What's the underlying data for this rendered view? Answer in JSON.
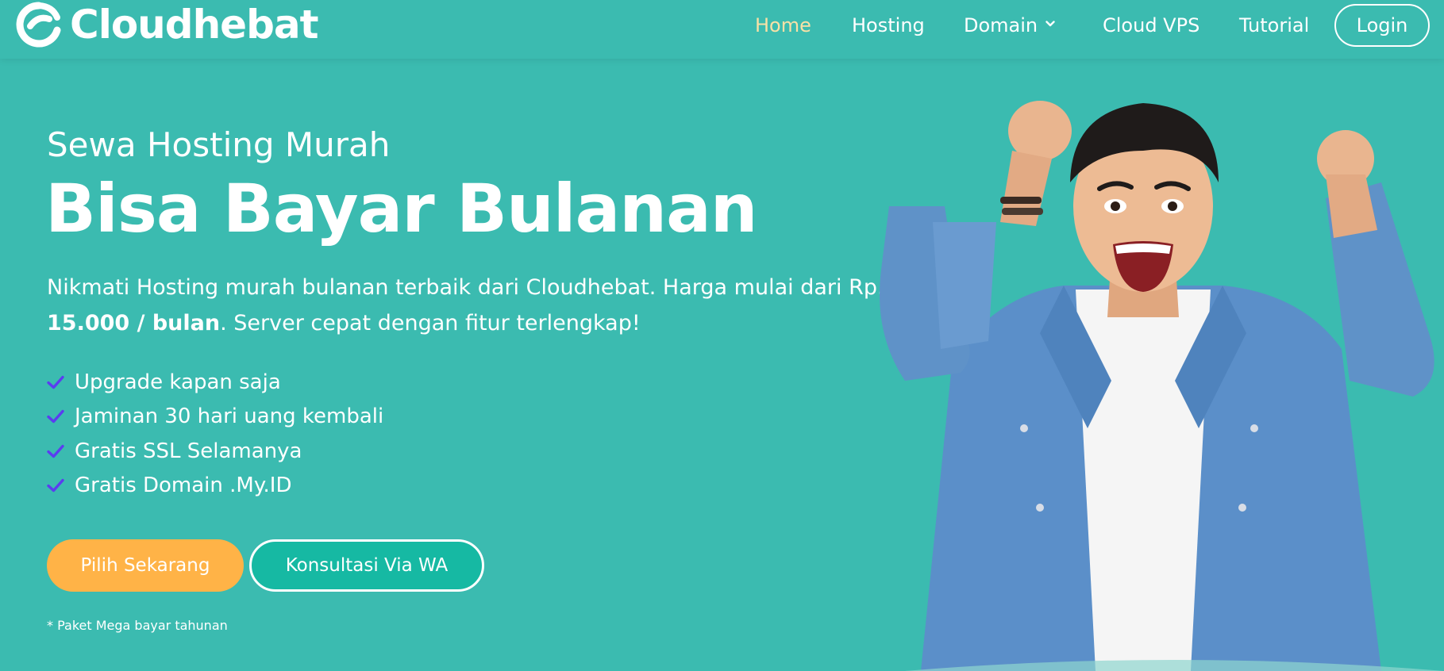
{
  "brand": {
    "name": "Cloudhebat",
    "logo_icon": "cloudhebat-logo-icon"
  },
  "nav": {
    "home": "Home",
    "hosting": "Hosting",
    "domain": "Domain",
    "cloud_vps": "Cloud VPS",
    "tutorial": "Tutorial",
    "login": "Login",
    "active_item": "Home"
  },
  "hero": {
    "subtitle": "Sewa Hosting Murah",
    "title": "Bisa Bayar Bulanan",
    "description_part1": "Nikmati Hosting murah bulanan terbaik dari Cloudhebat. Harga mulai dari Rp.",
    "description_price": "15.000 / bulan",
    "description_part2": ". Server cepat dengan fitur terlengkap!",
    "features": [
      "Upgrade kapan saja",
      "Jaminan 30 hari uang kembali",
      "Gratis SSL Selamanya",
      "Gratis Domain .My.ID"
    ],
    "primary_button": "Pilih Sekarang",
    "secondary_button": "Konsultasi Via WA",
    "footnote": "* Paket Mega bayar tahunan",
    "illustration": "excited-man-photo"
  },
  "colors": {
    "background": "#3bbbb0",
    "nav_active": "#f8e1a6",
    "primary_button": "#ffb347",
    "secondary_button": "#16b9a3",
    "check_icon": "#5b3df0",
    "text": "#ffffff"
  }
}
